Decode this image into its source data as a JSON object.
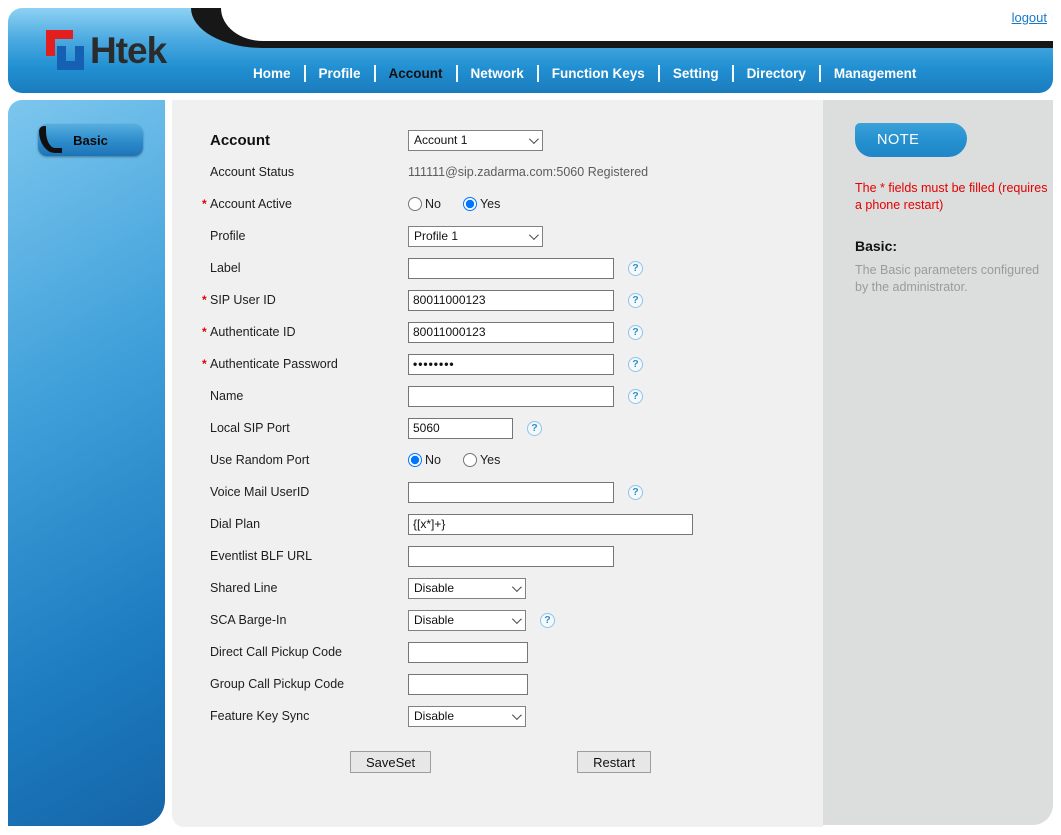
{
  "page": {
    "logout_label": "logout"
  },
  "brand": {
    "name": "Htek"
  },
  "nav": {
    "items": [
      {
        "label": "Home"
      },
      {
        "label": "Profile"
      },
      {
        "label": "Account"
      },
      {
        "label": "Network"
      },
      {
        "label": "Function Keys"
      },
      {
        "label": "Setting"
      },
      {
        "label": "Directory"
      },
      {
        "label": "Management"
      }
    ],
    "active": "Account"
  },
  "sidebar": {
    "basic_label": "Basic"
  },
  "icons": {
    "help": "?"
  },
  "form": {
    "required_marker": "*",
    "heading": "Account",
    "fields": {
      "account": {
        "label": "Account",
        "value": "Account 1"
      },
      "status": {
        "label": "Account Status",
        "value": "111111@sip.zadarma.com:5060 Registered"
      },
      "account_active": {
        "label": "Account Active",
        "no": "No",
        "yes": "Yes",
        "yes_checked": "checked"
      },
      "profile": {
        "label": "Profile",
        "value": "Profile 1"
      },
      "label": {
        "label": "Label",
        "value": ""
      },
      "sip_user_id": {
        "label": "SIP User ID",
        "value": "80011000123"
      },
      "auth_id": {
        "label": "Authenticate ID",
        "value": "80011000123"
      },
      "auth_password": {
        "label": "Authenticate Password",
        "value": "••••••••"
      },
      "name": {
        "label": "Name",
        "value": ""
      },
      "local_sip_port": {
        "label": "Local SIP Port",
        "value": "5060"
      },
      "use_random_port": {
        "label": "Use Random Port",
        "no": "No",
        "yes": "Yes",
        "no_checked": "checked"
      },
      "voice_mail": {
        "label": "Voice Mail UserID",
        "value": ""
      },
      "dial_plan": {
        "label": "Dial Plan",
        "value": "{[x*]+}"
      },
      "eventlist_blf": {
        "label": "Eventlist BLF URL",
        "value": ""
      },
      "shared_line": {
        "label": "Shared Line",
        "value": "Disable"
      },
      "sca_barge_in": {
        "label": "SCA Barge-In",
        "value": "Disable"
      },
      "direct_pickup": {
        "label": "Direct Call Pickup Code",
        "value": ""
      },
      "group_pickup": {
        "label": "Group Call Pickup Code",
        "value": ""
      },
      "feature_key_sync": {
        "label": "Feature Key Sync",
        "value": "Disable"
      }
    },
    "buttons": {
      "save": "SaveSet",
      "restart": "Restart"
    }
  },
  "note": {
    "title": "NOTE",
    "warning": "The * fields must be filled (requires a phone restart)",
    "heading": "Basic:",
    "description": "The Basic parameters configured by the administrator."
  }
}
